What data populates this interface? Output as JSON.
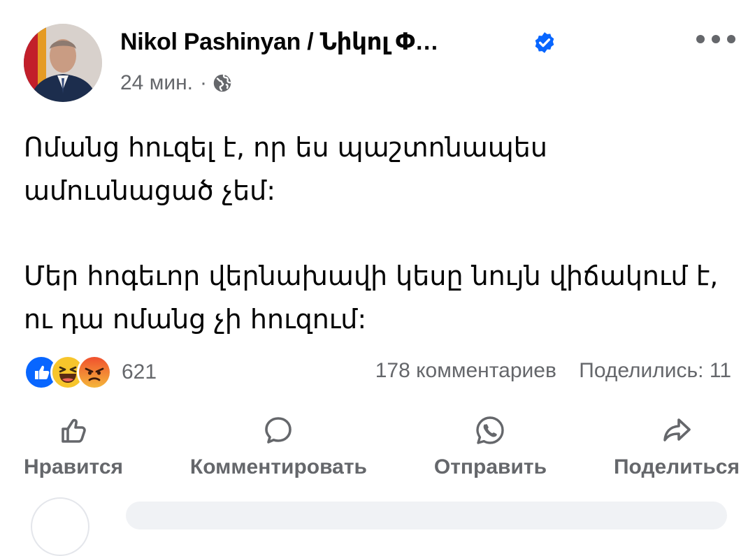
{
  "post": {
    "author": "Nikol Pashinyan / Նիկոլ Փ…",
    "time": "24 мин.",
    "separator": "·",
    "paragraphs": [
      "Ոմանց հուզել է, որ ես պաշտոնապես ամուսնացած չեմ:",
      "Մեր հոգեւոր վերնախավի կեսը նույն վիճակում է, ու դա ոմանց չի հուզում:"
    ]
  },
  "stats": {
    "reactions_count": "621",
    "comments": "178 комментариев",
    "shares": "Поделились: 11",
    "reaction_icons": [
      "like-icon",
      "haha-icon",
      "angry-icon"
    ]
  },
  "actions": {
    "like": "Нравится",
    "comment": "Комментировать",
    "send": "Отправить",
    "share": "Поделиться"
  },
  "colors": {
    "accent": "#0866ff",
    "secondary_text": "#65676b",
    "angry": "#f0502e",
    "haha": "#f7c52b"
  }
}
